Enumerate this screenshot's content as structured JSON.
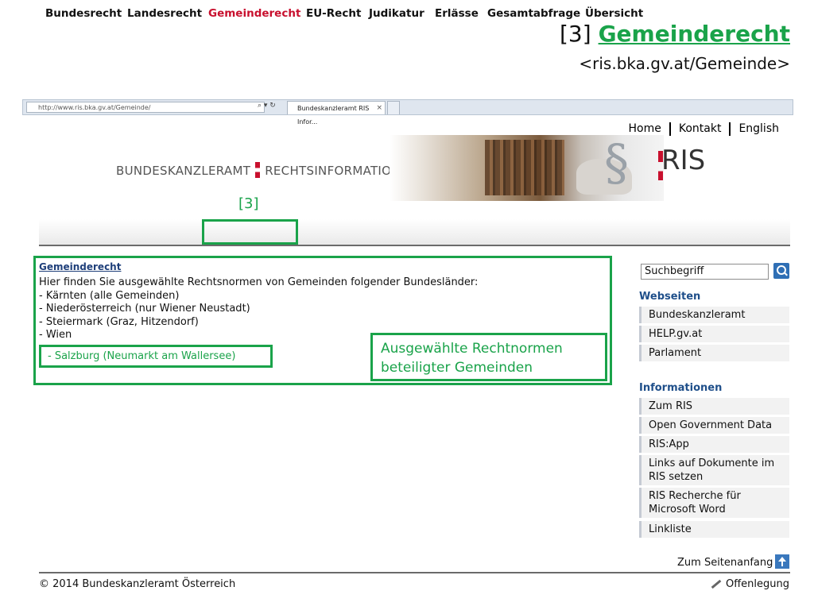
{
  "slide": {
    "ref": "[3]",
    "title_link": "Gemeinderecht",
    "url": "<ris.bka.gv.at/Gemeinde>"
  },
  "browser": {
    "address": "http://www.ris.bka.gv.at/Gemeinde/",
    "tab_title": "Bundeskanzleramt RIS Infor...",
    "tab_close": "×"
  },
  "header": {
    "top_links": [
      "Home",
      "Kontakt",
      "English"
    ],
    "brand_left": "BUNDESKANZLERAMT",
    "brand_right": "RECHTSINFORMATIONSSYSTEM",
    "logo_symbol": "§",
    "logo_text": "RIS",
    "annotation": "[3]"
  },
  "nav": {
    "items": [
      "Bundesrecht",
      "Landesrecht",
      "Gemeinderecht",
      "EU-Recht",
      "Judikatur",
      "Erlässe",
      "Gesamtabfrage",
      "Übersicht"
    ],
    "active": "Gemeinderecht"
  },
  "content": {
    "heading": "Gemeinderecht",
    "intro": "Hier finden Sie ausgewählte Rechtsnormen von Gemeinden folgender Bundesländer:",
    "states": [
      "- Kärnten (alle Gemeinden)",
      "- Niederösterreich (nur Wiener Neustadt)",
      "- Steiermark (Graz, Hitzendorf)",
      "- Wien"
    ],
    "salzburg": "- Salzburg (Neumarkt am Wallersee)",
    "note_line1": "Ausgewählte  Rechtnormen",
    "note_line2": "beteiligter Gemeinden"
  },
  "sidebar": {
    "search_value": "Suchbegriff",
    "webseiten_heading": "Webseiten",
    "webseiten": [
      "Bundeskanzleramt",
      "HELP.gv.at",
      "Parlament"
    ],
    "info_heading": "Informationen",
    "info": [
      "Zum RIS",
      "Open Government Data",
      "RIS:App",
      "Links auf Dokumente im RIS setzen",
      "RIS Recherche für Microsoft Word",
      "Linkliste"
    ]
  },
  "footer": {
    "to_top": "Zum Seitenanfang",
    "copyright": "© 2014 Bundeskanzleramt Österreich",
    "imprint": "Offenlegung"
  },
  "colors": {
    "annotation_green": "#1aa34a",
    "active_red": "#c8102e",
    "sidebar_heading_blue": "#1f4f8a"
  }
}
